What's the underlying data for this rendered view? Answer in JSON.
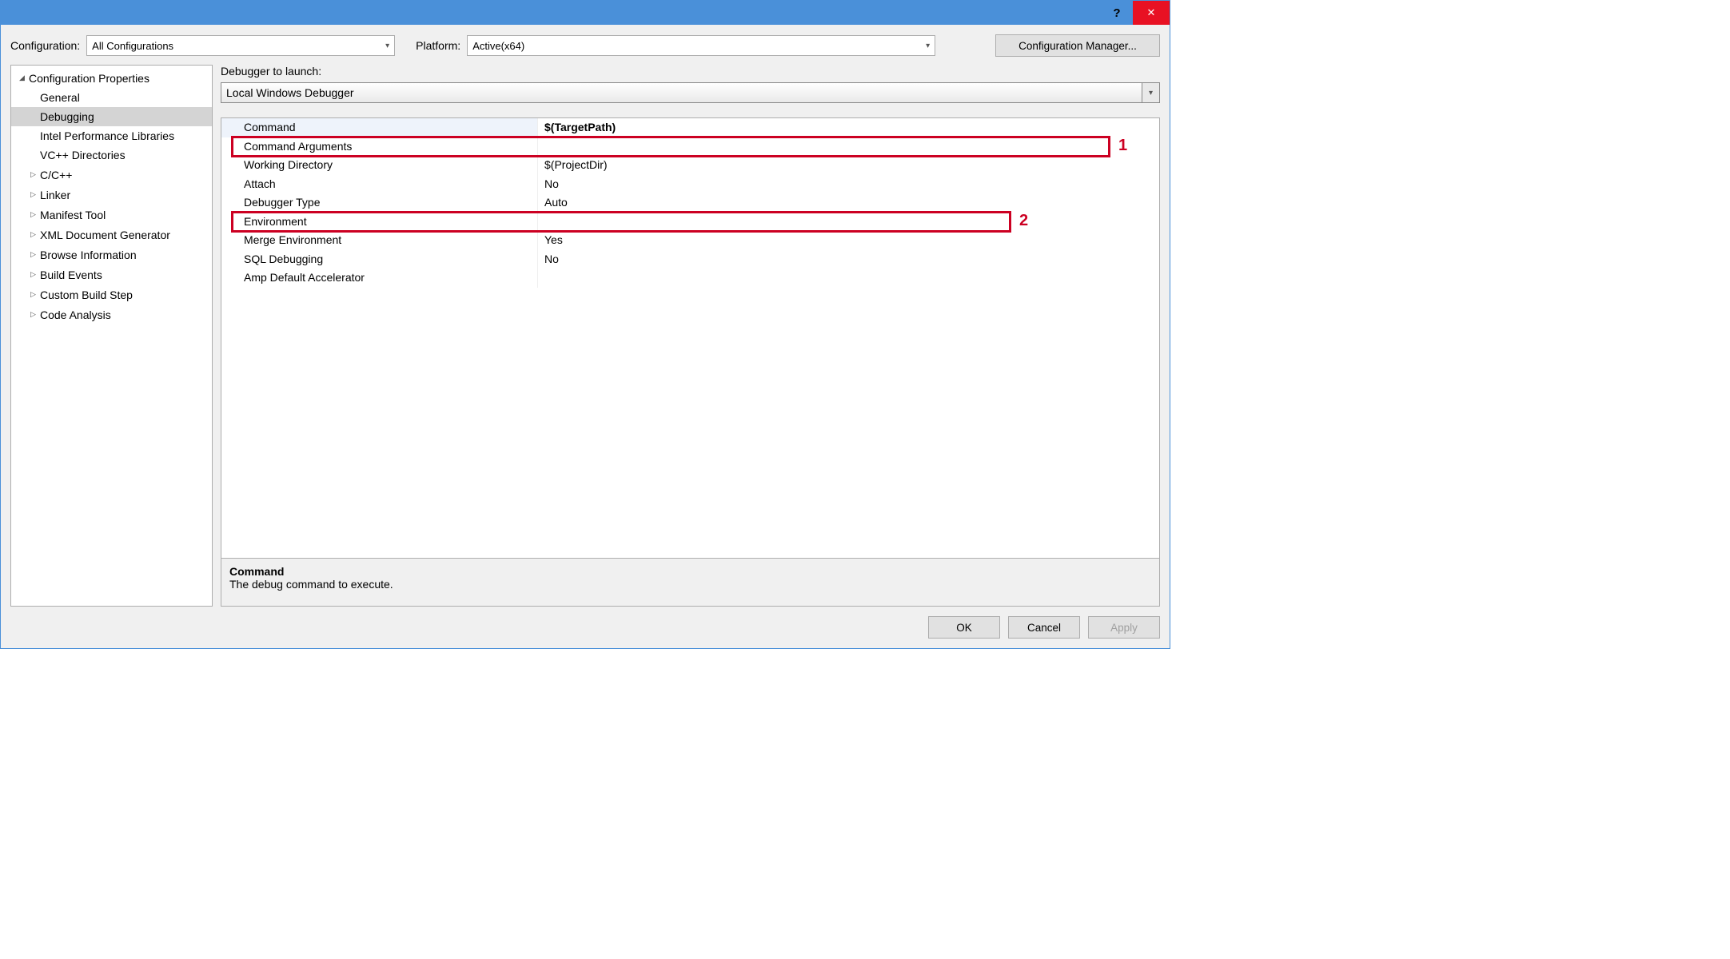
{
  "titlebar": {
    "help_icon": "?",
    "close_icon": "✕"
  },
  "top": {
    "configuration_label": "Configuration:",
    "configuration_value": "All Configurations",
    "platform_label": "Platform:",
    "platform_value": "Active(x64)",
    "config_manager_btn": "Configuration Manager..."
  },
  "tree": {
    "root": "Configuration Properties",
    "items": [
      {
        "label": "General",
        "arrow": "none",
        "depth": 1
      },
      {
        "label": "Debugging",
        "arrow": "none",
        "depth": 1,
        "selected": true
      },
      {
        "label": "Intel Performance Libraries",
        "arrow": "none",
        "depth": 1
      },
      {
        "label": "VC++ Directories",
        "arrow": "none",
        "depth": 1
      },
      {
        "label": "C/C++",
        "arrow": "closed",
        "depth": 1
      },
      {
        "label": "Linker",
        "arrow": "closed",
        "depth": 1
      },
      {
        "label": "Manifest Tool",
        "arrow": "closed",
        "depth": 1
      },
      {
        "label": "XML Document Generator",
        "arrow": "closed",
        "depth": 1
      },
      {
        "label": "Browse Information",
        "arrow": "closed",
        "depth": 1
      },
      {
        "label": "Build Events",
        "arrow": "closed",
        "depth": 1
      },
      {
        "label": "Custom Build Step",
        "arrow": "closed",
        "depth": 1
      },
      {
        "label": "Code Analysis",
        "arrow": "closed",
        "depth": 1
      }
    ]
  },
  "launch": {
    "label": "Debugger to launch:",
    "value": "Local Windows Debugger"
  },
  "props": [
    {
      "name": "Command",
      "value": "$(TargetPath)",
      "bold": true,
      "sel": true
    },
    {
      "name": "Command Arguments",
      "value": ""
    },
    {
      "name": "Working Directory",
      "value": "$(ProjectDir)"
    },
    {
      "name": "Attach",
      "value": "No"
    },
    {
      "name": "Debugger Type",
      "value": "Auto"
    },
    {
      "name": "Environment",
      "value": ""
    },
    {
      "name": "Merge Environment",
      "value": "Yes"
    },
    {
      "name": "SQL Debugging",
      "value": "No"
    },
    {
      "name": "Amp Default Accelerator",
      "value": ""
    }
  ],
  "desc": {
    "title": "Command",
    "text": "The debug command to execute."
  },
  "buttons": {
    "ok": "OK",
    "cancel": "Cancel",
    "apply": "Apply"
  },
  "callouts": {
    "one": "1",
    "two": "2"
  }
}
